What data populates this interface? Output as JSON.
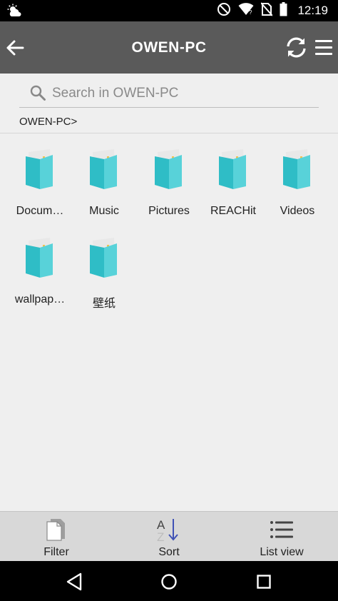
{
  "status_bar": {
    "time": "12:19",
    "icons": [
      "weather-icon",
      "do-not-disturb-icon",
      "wifi-icon",
      "no-sim-icon",
      "battery-icon"
    ]
  },
  "app_bar": {
    "title": "OWEN-PC",
    "icons": [
      "back-arrow-icon",
      "refresh-icon",
      "menu-icon"
    ]
  },
  "search": {
    "placeholder": "Search in OWEN-PC",
    "value": ""
  },
  "breadcrumb": "OWEN-PC>",
  "folders": [
    {
      "name": "Docum…"
    },
    {
      "name": "Music"
    },
    {
      "name": "Pictures"
    },
    {
      "name": "REACHit"
    },
    {
      "name": "Videos"
    },
    {
      "name": "wallpap…"
    },
    {
      "name": "壁纸"
    }
  ],
  "bottom_bar": {
    "filter_label": "Filter",
    "sort_label": "Sort",
    "list_view_label": "List view"
  },
  "colors": {
    "app_bar": "#5a5a5a",
    "folder": "#2fbdc6",
    "background": "#efefef",
    "bottom_bar": "#d8d8d8",
    "sort_arrow": "#3f51b5"
  }
}
